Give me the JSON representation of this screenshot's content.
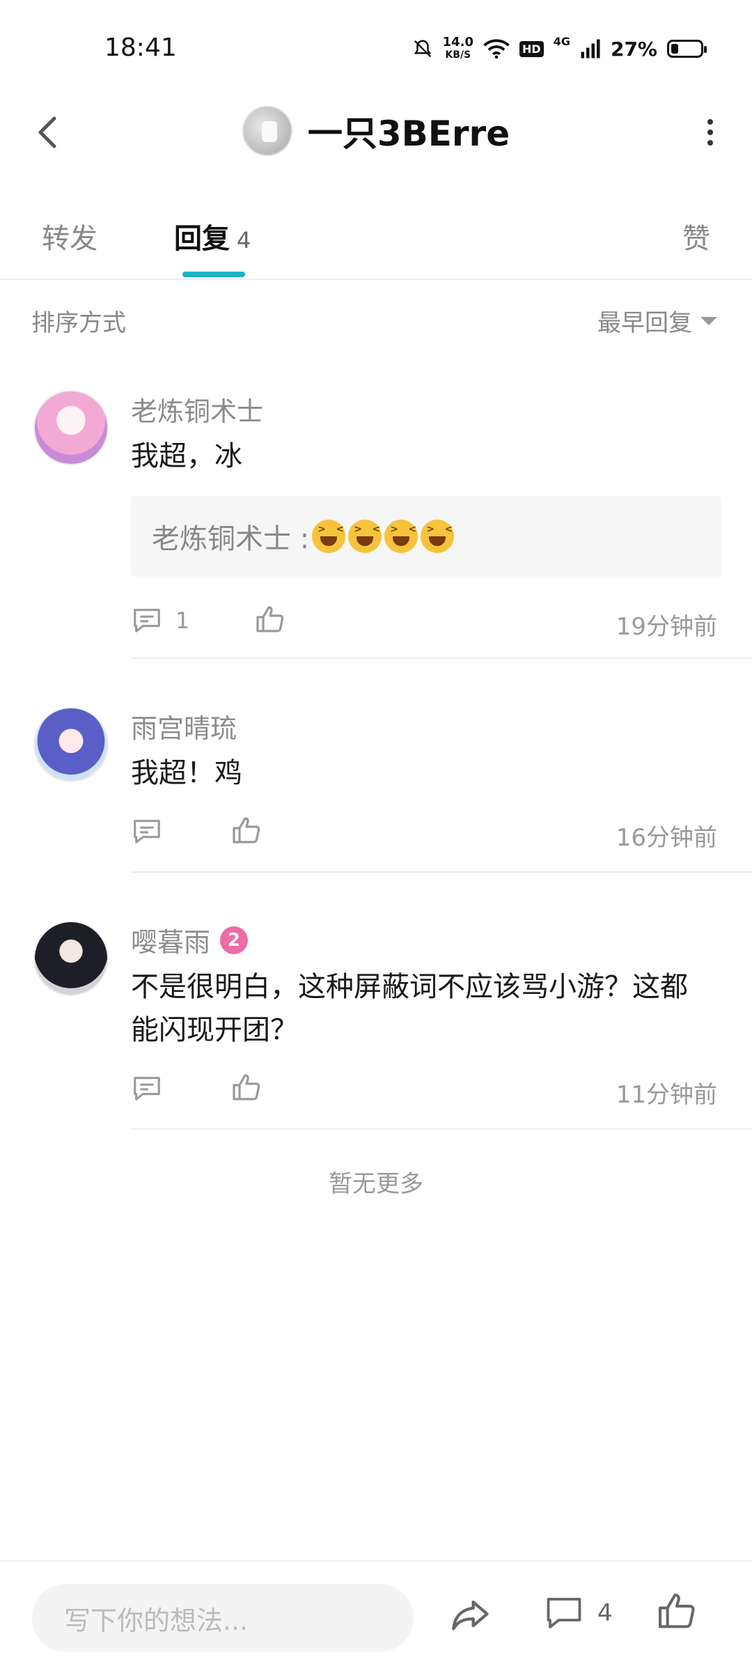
{
  "status_bar": {
    "time": "18:41",
    "net_speed_value": "14.0",
    "net_speed_unit": "KB/S",
    "hd": "HD",
    "network": "4G",
    "battery": "27%"
  },
  "header": {
    "title": "一只3BErre"
  },
  "tabs": {
    "forward": "转发",
    "reply": "回复",
    "reply_count": "4",
    "like": "赞"
  },
  "sort": {
    "label": "排序方式",
    "value": "最早回复"
  },
  "comments": [
    {
      "name": "老炼铜术士",
      "text": "我超，冰",
      "quote_author": "老炼铜术士 :",
      "reply_count": "1",
      "time": "19分钟前"
    },
    {
      "name": "雨宫晴琉",
      "text": "我超！鸡",
      "time": "16分钟前"
    },
    {
      "name": "嘤暮雨",
      "badge": "2",
      "text_line1": "不是很明白，这种屏蔽词不应该骂小游？这都",
      "text_line2": "能闪现开团？",
      "time": "11分钟前"
    }
  ],
  "footer_note": "暂无更多",
  "bottom_bar": {
    "placeholder": "写下你的想法...",
    "comment_count": "4"
  },
  "colors": {
    "accent": "#1bb2c3",
    "badge": "#f06aa6"
  }
}
